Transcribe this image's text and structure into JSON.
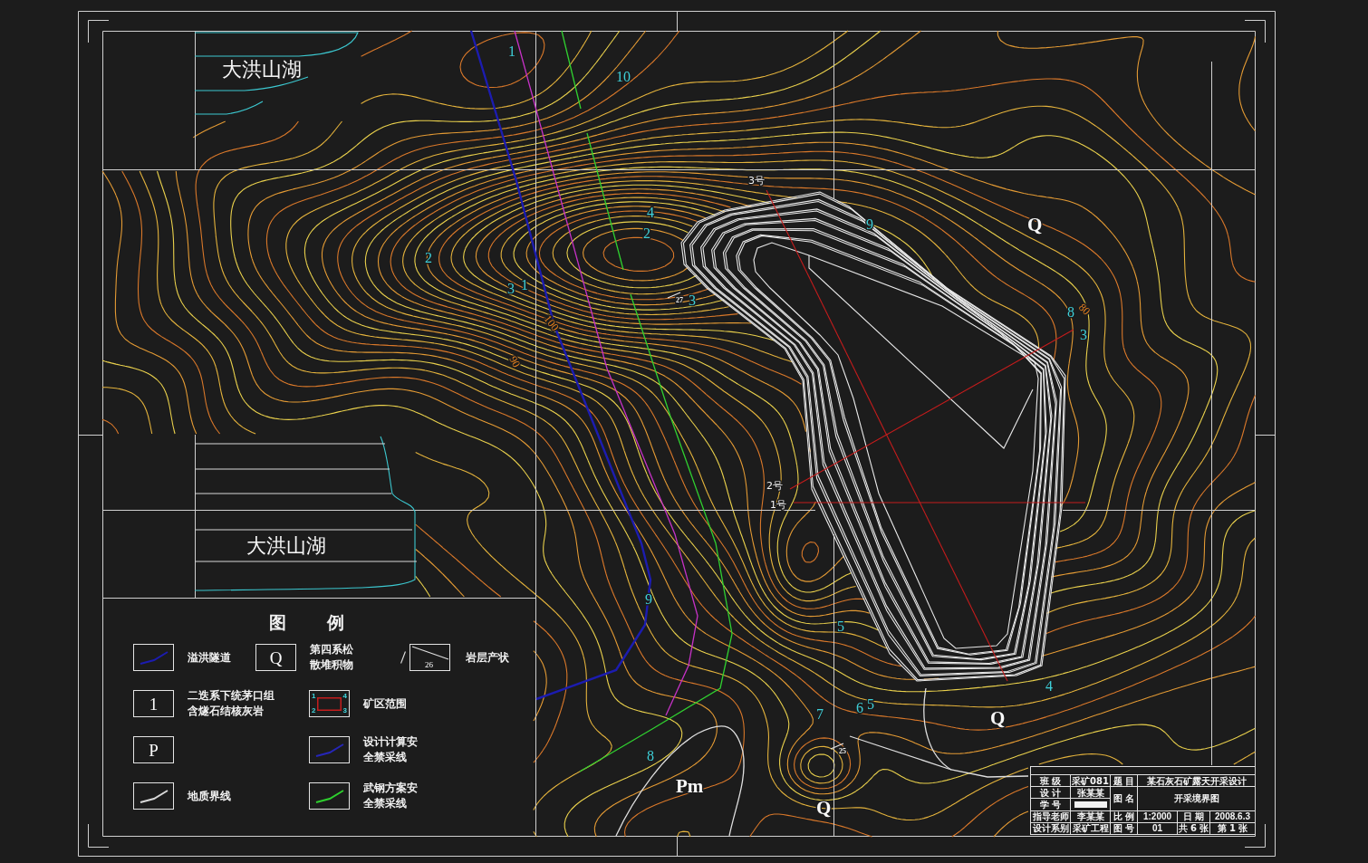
{
  "lakes": [
    {
      "name": "大洪山湖"
    },
    {
      "name": "大洪山湖"
    }
  ],
  "map_labels": [
    {
      "text": "1",
      "kind": "index"
    },
    {
      "text": "10",
      "kind": "index"
    },
    {
      "text": "4",
      "kind": "index"
    },
    {
      "text": "2",
      "kind": "index"
    },
    {
      "text": "2",
      "kind": "index"
    },
    {
      "text": "3",
      "kind": "index"
    },
    {
      "text": "1",
      "kind": "index"
    },
    {
      "text": "100",
      "kind": "elevation"
    },
    {
      "text": "90",
      "kind": "elevation"
    },
    {
      "text": "27",
      "kind": "dip"
    },
    {
      "text": "3",
      "kind": "index"
    },
    {
      "text": "9",
      "kind": "index"
    },
    {
      "text": "Q",
      "kind": "rock"
    },
    {
      "text": "8",
      "kind": "index"
    },
    {
      "text": "80",
      "kind": "elevation"
    },
    {
      "text": "3",
      "kind": "index"
    },
    {
      "text": "9",
      "kind": "index"
    },
    {
      "text": "5",
      "kind": "index"
    },
    {
      "text": "7",
      "kind": "index"
    },
    {
      "text": "6",
      "kind": "index"
    },
    {
      "text": "5",
      "kind": "index"
    },
    {
      "text": "4",
      "kind": "index"
    },
    {
      "text": "Q",
      "kind": "rock"
    },
    {
      "text": "25",
      "kind": "dip"
    },
    {
      "text": "8",
      "kind": "index"
    },
    {
      "text": "Pm",
      "kind": "rock"
    },
    {
      "text": "Q",
      "kind": "rock"
    }
  ],
  "sections": [
    {
      "label": "3号"
    },
    {
      "label": "2号"
    },
    {
      "label": "1号"
    }
  ],
  "legend": {
    "title": "图 例",
    "items": [
      {
        "kind": "line",
        "color": "#1c1cb0",
        "label": "溢洪隧道"
      },
      {
        "kind": "symbol",
        "symbol": "Q",
        "label": "第四系松散堆积物"
      },
      {
        "kind": "dip",
        "symbol": "26",
        "label": "岩层产状"
      },
      {
        "kind": "symbol",
        "symbol": "1",
        "label": "二迭系下统茅口组含燧石结核灰岩"
      },
      {
        "kind": "area",
        "corners": [
          "1",
          "4",
          "2",
          "3"
        ],
        "label": "矿区范围"
      },
      {
        "kind": "symbol",
        "symbol": "P"
      },
      {
        "kind": "line",
        "color": "#2626b8",
        "label": "设计计算安全禁采线"
      },
      {
        "kind": "line",
        "color": "#d8d8d8",
        "label": "地质界线"
      },
      {
        "kind": "line",
        "color": "#2ed02e",
        "label": "武钢方案安全禁采线"
      }
    ]
  },
  "title_block": {
    "class_label": "班 级",
    "class_value": "采矿081",
    "subject_label": "题 目",
    "subject": "某石灰石矿露天开采设计",
    "designer_label": "设 计",
    "designer": "张某某",
    "number_label": "学 号",
    "drawing_name_label": "图 名",
    "drawing_name": "开采境界图",
    "advisor_label": "指导老师",
    "advisor": "李某某",
    "scale_label": "比 例",
    "scale": "1:2000",
    "date_label": "日 期",
    "date": "2008.6.3",
    "department_label": "设计系别",
    "department": "采矿工程",
    "drawing_no_label": "图 号",
    "drawing_no": "01",
    "sheet_count": "共 6 张",
    "sheet_index": "第 1 张"
  }
}
